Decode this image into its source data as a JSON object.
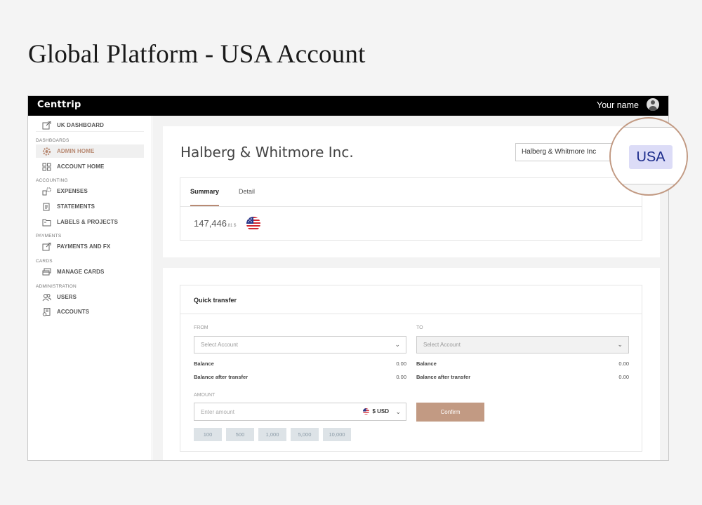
{
  "heading": "Global Platform - USA Account",
  "topbar": {
    "logo": "Centtrip",
    "user_name": "Your name"
  },
  "sidebar": {
    "top_link": "UK DASHBOARD",
    "sections": {
      "dashboards": "DASHBOARDS",
      "accounting": "ACCOUNTING",
      "payments": "PAYMENTS",
      "cards": "CARDS",
      "administration": "ADMINISTRATION"
    },
    "items": {
      "admin_home": "ADMIN HOME",
      "account_home": "ACCOUNT HOME",
      "expenses": "EXPENSES",
      "statements": "STATEMENTS",
      "labels_projects": "LABELS & PROJECTS",
      "payments_fx": "PAYMENTS AND FX",
      "manage_cards": "MANAGE CARDS",
      "users": "USERS",
      "accounts": "ACCOUNTS"
    },
    "active_item": "admin_home",
    "accent_color": "#b88a73"
  },
  "company": {
    "name": "Halberg & Whitmore Inc.",
    "selector_value": "Halberg & Whitmore Inc"
  },
  "region_badge": "USA",
  "tabs": {
    "summary": "Summary",
    "detail": "Detail",
    "active": "summary"
  },
  "balance": {
    "main": "147,446",
    "decimals": ".81 $",
    "flag": "us-flag-icon"
  },
  "quick_transfer": {
    "title": "Quick transfer",
    "from_label": "FROM",
    "to_label": "TO",
    "from_placeholder": "Select Account",
    "to_placeholder": "Select Account",
    "balance_label": "Balance",
    "balance_after_label": "Balance after transfer",
    "from_balance": "0.00",
    "from_balance_after": "0.00",
    "to_balance": "0.00",
    "to_balance_after": "0.00",
    "amount_label": "AMOUNT",
    "amount_placeholder": "Enter amount",
    "currency": "$ USD",
    "confirm_label": "Confirm",
    "quick_amounts": [
      "100",
      "500",
      "1,000",
      "5,000",
      "10,000"
    ]
  }
}
